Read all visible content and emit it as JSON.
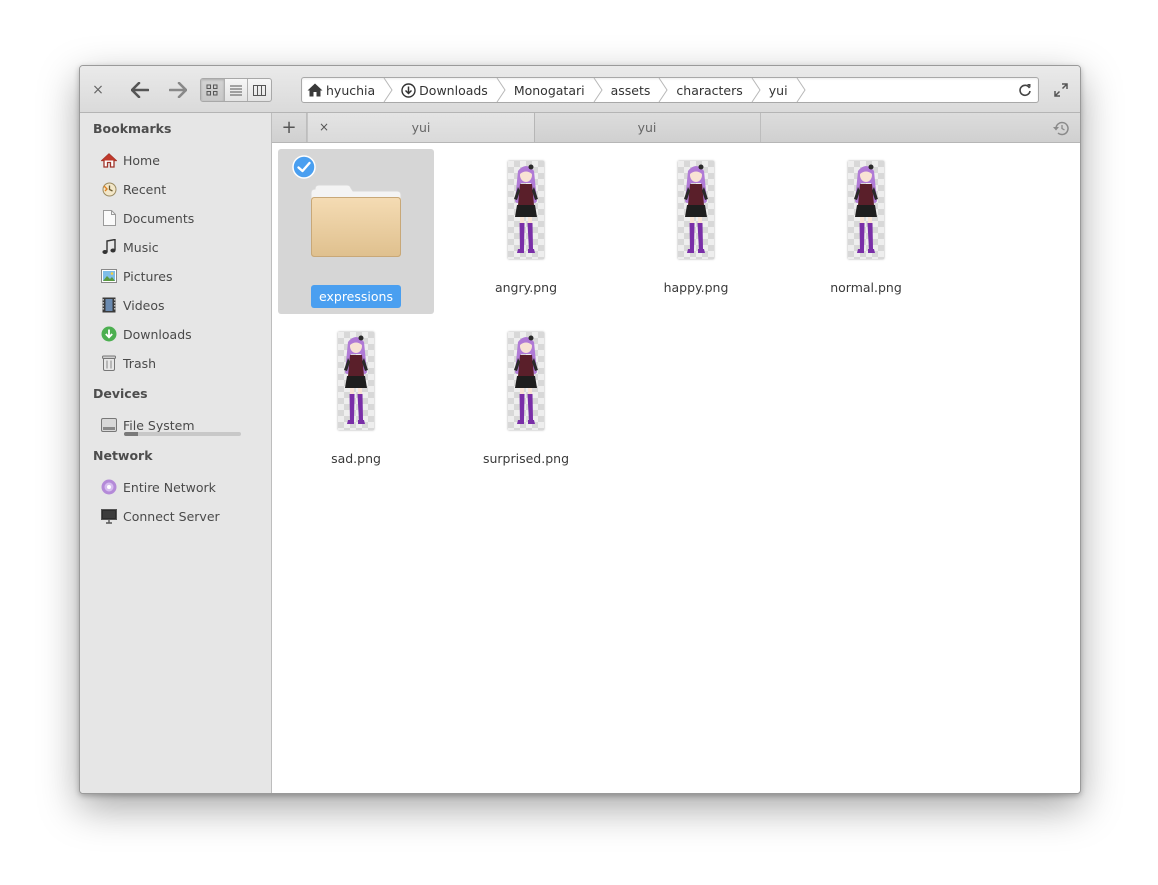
{
  "headerbar": {
    "close_symbol": "×",
    "back_icon": "arrow-left-icon",
    "forward_icon": "arrow-right-icon",
    "view_modes": [
      "icon-view",
      "list-view",
      "column-view"
    ],
    "active_view": "icon-view",
    "breadcrumbs": [
      {
        "label": "hyuchia",
        "icon": "home-icon"
      },
      {
        "label": "Downloads",
        "icon": "download-icon"
      },
      {
        "label": "Monogatari"
      },
      {
        "label": "assets"
      },
      {
        "label": "characters"
      },
      {
        "label": "yui"
      }
    ],
    "reload_icon": "reload-icon",
    "fullscreen_icon": "fullscreen-icon"
  },
  "sidebar": {
    "bookmarks_heading": "Bookmarks",
    "bookmarks": [
      {
        "label": "Home",
        "icon": "home-icon"
      },
      {
        "label": "Recent",
        "icon": "recent-icon"
      },
      {
        "label": "Documents",
        "icon": "documents-icon"
      },
      {
        "label": "Music",
        "icon": "music-icon"
      },
      {
        "label": "Pictures",
        "icon": "pictures-icon"
      },
      {
        "label": "Videos",
        "icon": "videos-icon"
      },
      {
        "label": "Downloads",
        "icon": "downloads-icon"
      },
      {
        "label": "Trash",
        "icon": "trash-icon"
      }
    ],
    "devices_heading": "Devices",
    "devices": [
      {
        "label": "File System",
        "icon": "drive-icon",
        "usage_fraction": 0.12
      }
    ],
    "network_heading": "Network",
    "network": [
      {
        "label": "Entire Network",
        "icon": "network-icon"
      },
      {
        "label": "Connect Server",
        "icon": "server-icon"
      }
    ]
  },
  "tabs": {
    "new_tab_symbol": "+",
    "close_symbol": "×",
    "items": [
      {
        "label": "yui",
        "active": true
      },
      {
        "label": "yui",
        "active": false
      }
    ],
    "history_icon": "history-icon"
  },
  "files": [
    {
      "name": "expressions",
      "type": "folder",
      "selected": true
    },
    {
      "name": "angry.png",
      "type": "image"
    },
    {
      "name": "happy.png",
      "type": "image"
    },
    {
      "name": "normal.png",
      "type": "image"
    },
    {
      "name": "sad.png",
      "type": "image"
    },
    {
      "name": "surprised.png",
      "type": "image"
    }
  ],
  "colors": {
    "selection": "#4a9ff0",
    "folder": "#e9cfa3",
    "character_hair": "#b07ad6",
    "character_stockings": "#7a2fa8"
  }
}
